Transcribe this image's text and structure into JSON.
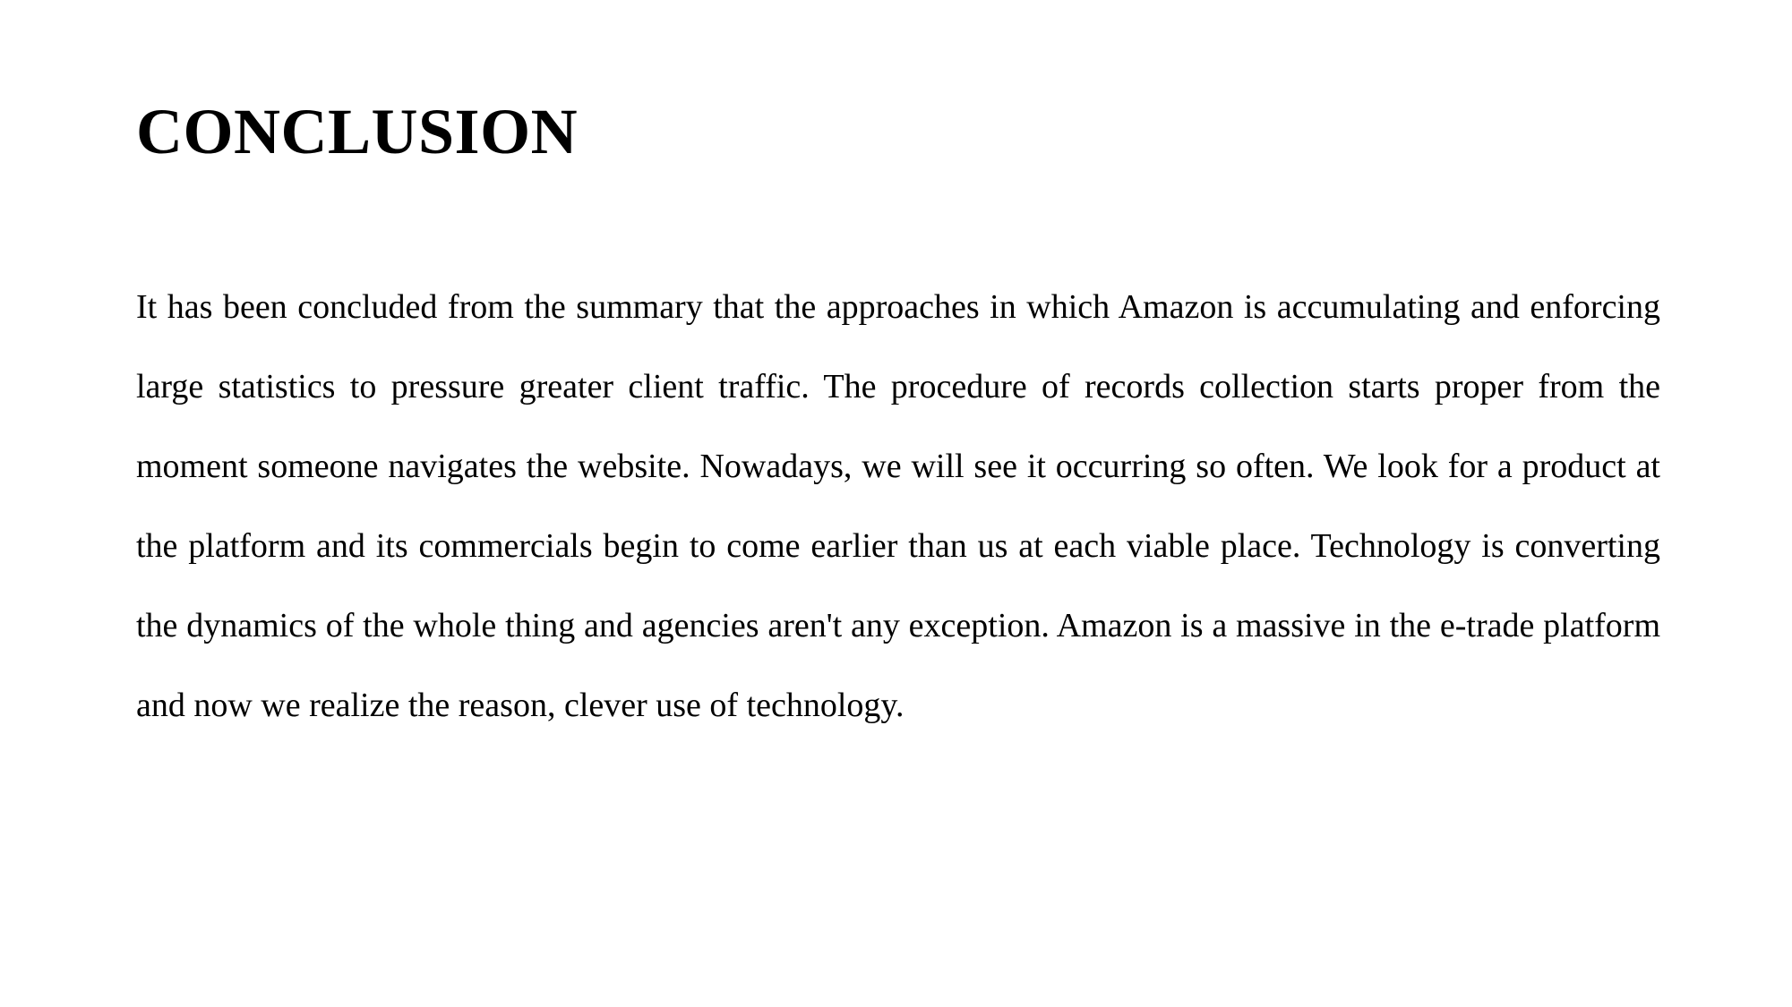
{
  "document": {
    "heading": "CONCLUSION",
    "body_paragraph": "It has been concluded from the summary that the approaches in which Amazon is accumulating and enforcing large statistics to pressure greater client traffic. The procedure of records collection starts proper from the moment someone navigates the website. Nowadays, we will see it occurring so often. We look for a product at the platform and its commercials begin to come earlier than us at each viable place. Technology is converting the dynamics of the whole thing and agencies aren't any exception. Amazon is a massive in the e-trade platform and now we realize the reason, clever use of technology.",
    "colors": {
      "page_background": "#ffffff",
      "text": "#000000"
    }
  }
}
